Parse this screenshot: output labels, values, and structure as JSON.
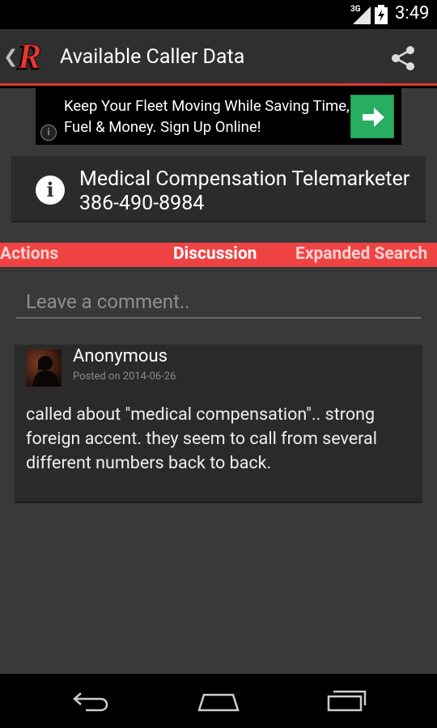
{
  "status_bar": {
    "network": "3G",
    "time": "3:49"
  },
  "action_bar": {
    "title": "Available Caller Data",
    "logo_letter": "R"
  },
  "ad": {
    "text": "Keep Your Fleet Moving While Saving Time, Fuel & Money. Sign Up Online!",
    "info_glyph": "i"
  },
  "caller": {
    "name": "Medical Compensation Telemarketer",
    "number": "386-490-8984",
    "icon_glyph": "i"
  },
  "tabs": {
    "actions": "Actions",
    "discussion": "Discussion",
    "expanded": "Expanded Search"
  },
  "comment_input": {
    "placeholder": "Leave a comment.."
  },
  "comment": {
    "author": "Anonymous",
    "posted_prefix": "Posted on ",
    "posted_date": "2014-06-26",
    "body": "called about \"medical compensation\".. strong foreign accent. they seem to call from several different numbers back to back."
  },
  "colors": {
    "accent": "#e53935",
    "tab_bg": "#ef4343",
    "ad_button": "#27ae60"
  }
}
